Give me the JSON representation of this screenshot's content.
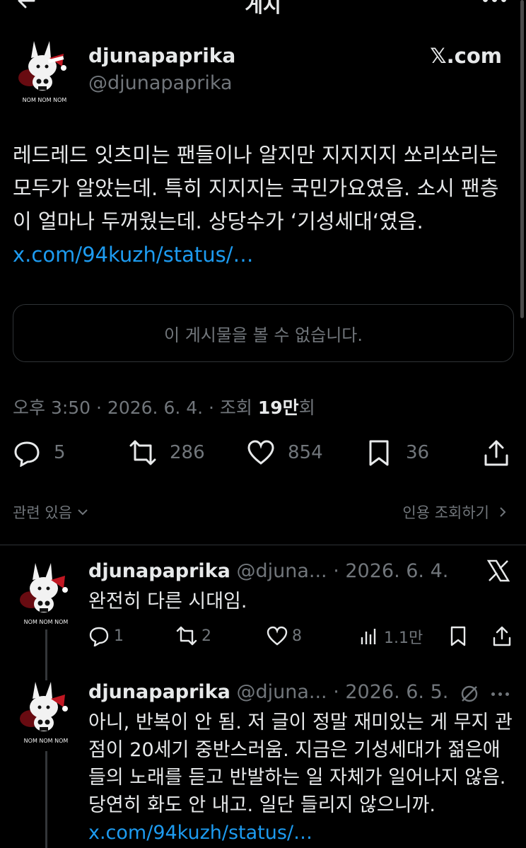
{
  "topbar": {
    "title": "게시"
  },
  "main_post": {
    "display_name": "djunapaprika",
    "handle": "@djunapaprika",
    "source": "𝕏.com",
    "text": "레드레드 잇츠미는 팬들이나 알지만 지지지지 쏘리쏘리는 모두가 알았는데. 특히 지지지는 국민가요였음. 소시 팬층이 얼마나 두꺼웠는데. 상당수가 ‘기성세대‘였음. ",
    "link": "x.com/94kuzh/status/…",
    "unavailable": "이 게시물을 볼 수 없습니다.",
    "meta_prefix": "오후 3:50 · 2026. 6. 4. · 조회 ",
    "meta_views": "19만",
    "meta_suffix": "회",
    "replies": "5",
    "reposts": "286",
    "likes": "854",
    "bookmarks": "36"
  },
  "related_label": "관련 있음",
  "quotes_label": "인용 조회하기",
  "reply1": {
    "display_name": "djunapaprika",
    "handle_date": "@djuna... · 2026. 6. 4.",
    "text": "완전히 다른 시대임.",
    "replies": "1",
    "reposts": "2",
    "likes": "8",
    "views": "1.1만"
  },
  "reply2": {
    "display_name": "djunapaprika",
    "handle_date": "@djuna... · 2026. 6. 5.",
    "text": "아니, 반복이 안 됨. 저 글이 정말 재미있는 게 무지 관점이 20세기 중반스러움. 지금은 기성세대가 젊은애들의 노래를 듣고 반발하는 일 자체가 일어나지 않음. 당연히 화도 안 내고. 일단 들리지 않으니까. ",
    "link": "x.com/94kuzh/status/…"
  },
  "avatar": {
    "caption": "NOM NOM NOM"
  },
  "colors": {
    "link": "#1d9bf0",
    "muted": "#71767b",
    "text": "#e7e9ea",
    "border": "#2f3336"
  }
}
